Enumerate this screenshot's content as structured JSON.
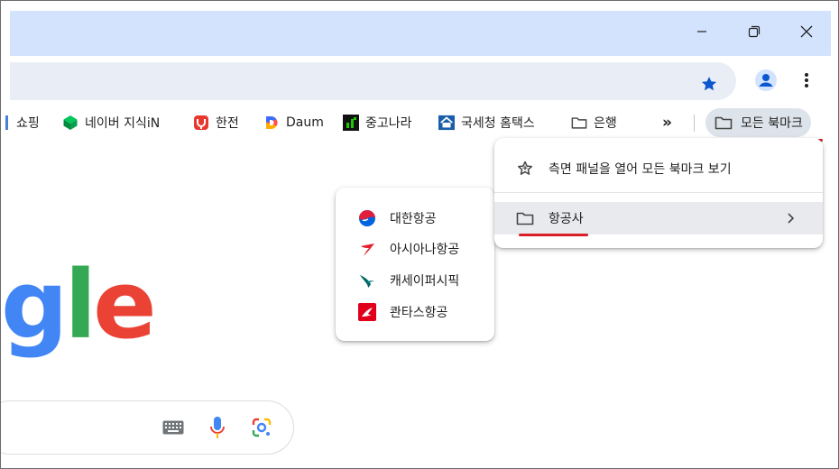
{
  "window": {
    "controls": [
      "minimize-icon",
      "restore-icon",
      "close-icon"
    ]
  },
  "toolbar": {
    "star_icon": "star-icon",
    "profile_icon": "profile-icon",
    "menu_icon": "kebab-menu-icon"
  },
  "bookmarks_bar": {
    "items": [
      {
        "label": "쇼핑",
        "icon": "bookmark-favicon"
      },
      {
        "label": "네이버 지식iN",
        "icon": "naver-kin-favicon"
      },
      {
        "label": "한전",
        "icon": "kepco-favicon"
      },
      {
        "label": "Daum",
        "icon": "daum-favicon"
      },
      {
        "label": "중고나라",
        "icon": "joonggonara-favicon"
      },
      {
        "label": "국세청 홈택스",
        "icon": "hometax-favicon"
      },
      {
        "label": "은행",
        "icon": "folder-icon"
      }
    ],
    "overflow_label": "»",
    "all_bookmarks_label": "모든 북마크"
  },
  "page": {
    "logo_partial": [
      "g",
      "l",
      "e"
    ],
    "search_icons": [
      "keyboard-icon",
      "mic-icon",
      "google-lens-icon"
    ]
  },
  "all_bookmarks_menu": {
    "open_side_panel_label": "측면 패널을 열어 모든 북마크 보기",
    "folder_label": "항공사"
  },
  "airlines_submenu": {
    "items": [
      {
        "label": "대한항공",
        "icon": "korean-air-favicon",
        "color": "#0064de"
      },
      {
        "label": "아시아나항공",
        "icon": "asiana-favicon",
        "color": "#e3202b"
      },
      {
        "label": "캐세이퍼시픽",
        "icon": "cathay-favicon",
        "color": "#006564"
      },
      {
        "label": "콴타스항공",
        "icon": "qantas-favicon",
        "color": "#e0001b"
      }
    ]
  },
  "colors": {
    "titlebar": "#d3e3fd",
    "omnibox": "#e9eef6",
    "accent_blue": "#0b57d0",
    "annotation_red": "#d91e26"
  }
}
